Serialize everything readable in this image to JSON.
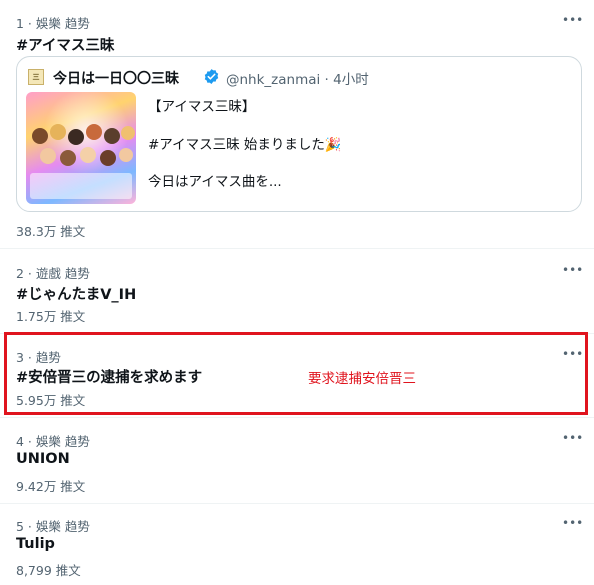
{
  "trends": [
    {
      "meta": "1 · 娛樂 趋势",
      "title": "#アイマス三昧",
      "count": "38.3万 推文"
    },
    {
      "meta": "2 · 遊戲 趋势",
      "title": "#じゃんたまV_IH",
      "count": "1.75万 推文"
    },
    {
      "meta": "3 · 趋势",
      "title": "#安倍晋三の逮捕を求めます",
      "count": "5.95万 推文"
    },
    {
      "meta": "4 · 娛樂 趋势",
      "title": "UNION",
      "count": "9.42万 推文"
    },
    {
      "meta": "5 · 娛樂 趋势",
      "title": "Tulip",
      "count": "8,799 推文"
    }
  ],
  "more_label": "•••",
  "tweet": {
    "author": "今日は一日〇〇三昧",
    "handle_time": "@nhk_zanmai · 4小时",
    "line1": "【アイマス三昧】",
    "line2": "#アイマス三昧 始まりました🎉",
    "line3": "今日はアイマス曲を..."
  },
  "annotation": "要求逮捕安倍晋三",
  "colors": {
    "accent": "#1d9bf0",
    "annotation": "#e0141e"
  }
}
